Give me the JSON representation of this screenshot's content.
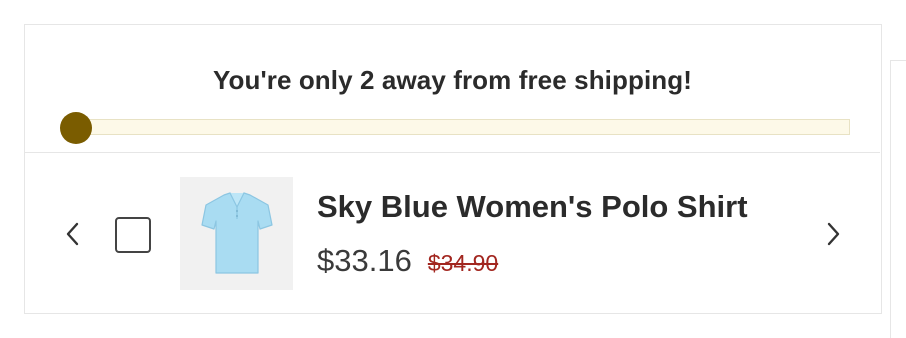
{
  "shipping": {
    "message": "You're only 2 away from free shipping!",
    "progress": 0,
    "accent_color": "#7a5c00"
  },
  "product": {
    "title": "Sky Blue Women's Polo Shirt",
    "price": "$33.16",
    "compare_price": "$34.90",
    "selected": false,
    "image_icon": "polo-shirt-icon"
  },
  "nav": {
    "prev_icon": "chevron-left-icon",
    "next_icon": "chevron-right-icon"
  }
}
